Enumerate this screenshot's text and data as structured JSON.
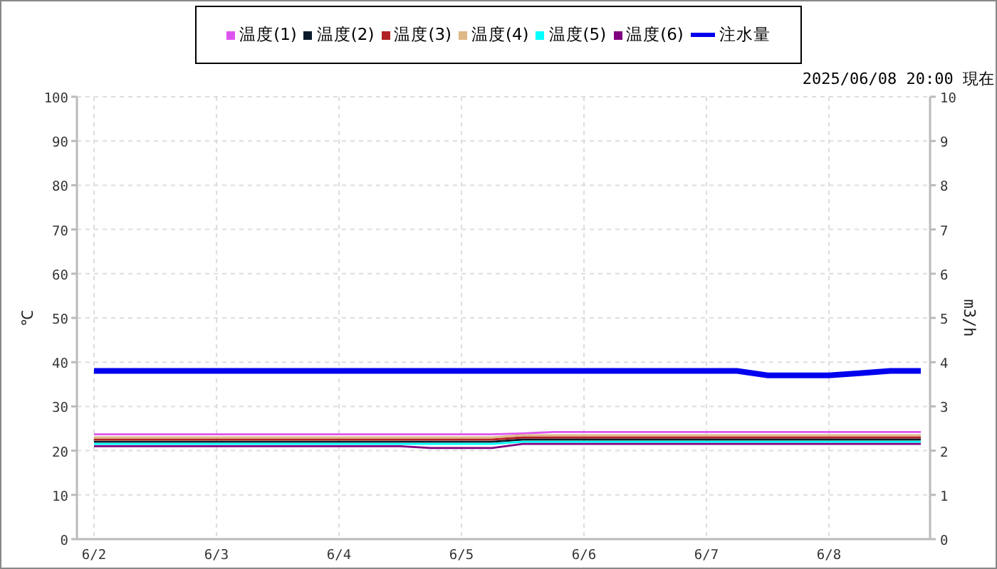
{
  "chart": {
    "timestamp": "2025/06/08 20:00 現在",
    "chart_data": {
      "type": "line",
      "grid": true,
      "ylabel": "℃",
      "y2label": "m3/h",
      "ylim": [
        0,
        100
      ],
      "y2lim": [
        0,
        10
      ],
      "yticks": [
        0,
        10,
        20,
        30,
        40,
        50,
        60,
        70,
        80,
        90,
        100
      ],
      "y2ticks": [
        0,
        1,
        2,
        3,
        4,
        5,
        6,
        7,
        8,
        9,
        10
      ],
      "categories": [
        "6/2",
        null,
        null,
        null,
        "6/3",
        null,
        null,
        null,
        "6/4",
        null,
        null,
        null,
        "6/5",
        null,
        null,
        null,
        "6/6",
        null,
        null,
        null,
        "6/7",
        null,
        null,
        null,
        "6/8",
        null,
        null,
        null
      ],
      "series": [
        {
          "name": "温度(1)",
          "color": "#dd55ee",
          "values": [
            23.7,
            23.7,
            23.7,
            23.7,
            23.7,
            23.7,
            23.7,
            23.7,
            23.7,
            23.7,
            23.7,
            23.7,
            23.7,
            23.7,
            23.9,
            24.2,
            24.2,
            24.2,
            24.2,
            24.2,
            24.2,
            24.2,
            24.2,
            24.2,
            24.2,
            24.2,
            24.2,
            24.2
          ]
        },
        {
          "name": "温度(2)",
          "color": "#0a1a2a",
          "values": [
            22,
            22,
            22,
            22,
            22,
            22,
            22,
            22,
            22,
            22,
            22,
            22,
            22,
            22,
            22.5,
            22.5,
            22.5,
            22.5,
            22.5,
            22.5,
            22.5,
            22.5,
            22.5,
            22.5,
            22.5,
            22.5,
            22.5,
            22.5
          ]
        },
        {
          "name": "温度(3)",
          "color": "#b22222",
          "values": [
            22.5,
            22.5,
            22.5,
            22.5,
            22.5,
            22.5,
            22.5,
            22.5,
            22.5,
            22.5,
            22.5,
            22.5,
            22.5,
            22.5,
            23,
            23,
            23,
            23,
            23,
            23,
            23,
            23,
            23,
            23,
            23,
            23,
            23,
            23
          ]
        },
        {
          "name": "温度(4)",
          "color": "#deb887",
          "values": [
            23,
            23,
            23,
            23,
            23,
            23,
            23,
            23,
            23,
            23,
            23,
            23,
            23,
            23,
            23.5,
            23.5,
            23.5,
            23.5,
            23.5,
            23.5,
            23.5,
            23.5,
            23.5,
            23.5,
            23.5,
            23.5,
            23.5,
            23.5
          ]
        },
        {
          "name": "温度(5)",
          "color": "#00ffff",
          "values": [
            21.5,
            21.5,
            21.5,
            21.5,
            21.5,
            21.5,
            21.5,
            21.5,
            21.5,
            21.5,
            21.5,
            21.5,
            21.5,
            21.5,
            22,
            22,
            22,
            22,
            22,
            22,
            22,
            22,
            22,
            22,
            22,
            22,
            22,
            22
          ]
        },
        {
          "name": "温度(6)",
          "color": "#800080",
          "values": [
            21,
            21,
            21,
            21,
            21,
            21,
            21,
            21,
            21,
            21,
            21,
            20.6,
            20.6,
            20.6,
            21.5,
            21.5,
            21.5,
            21.5,
            21.5,
            21.5,
            21.5,
            21.5,
            21.5,
            21.5,
            21.5,
            21.5,
            21.5,
            21.5
          ]
        },
        {
          "name": "注水量",
          "color": "#0000ee",
          "axis": "y2",
          "values": [
            3.8,
            3.8,
            3.8,
            3.8,
            3.8,
            3.8,
            3.8,
            3.8,
            3.8,
            3.8,
            3.8,
            3.8,
            3.8,
            3.8,
            3.8,
            3.8,
            3.8,
            3.8,
            3.8,
            3.8,
            3.8,
            3.8,
            3.7,
            3.7,
            3.7,
            3.75,
            3.8,
            3.8
          ]
        }
      ]
    }
  }
}
